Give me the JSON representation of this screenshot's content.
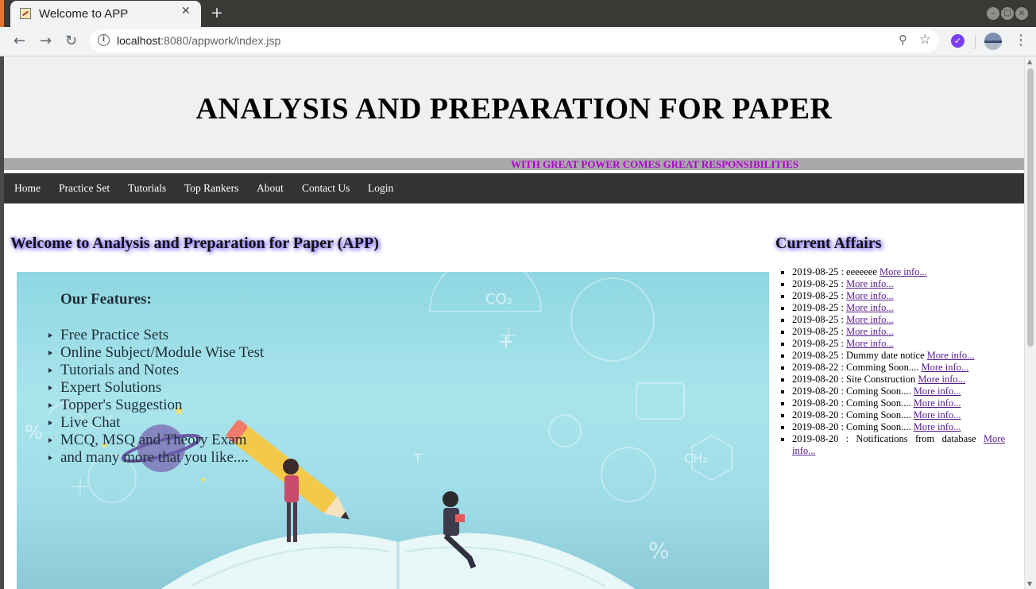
{
  "browser": {
    "tab_title": "Welcome to APP",
    "url_host": "localhost",
    "url_rest": ":8080/appwork/index.jsp"
  },
  "site": {
    "title": "ANALYSIS AND PREPARATION FOR PAPER",
    "tagline": "WITH GREAT POWER COMES GREAT RESPONSIBILITIES",
    "nav": [
      "Home",
      "Practice Set",
      "Tutorials",
      "Top Rankers",
      "About",
      "Contact Us",
      "Login"
    ],
    "welcome_heading": "Welcome to Analysis and Preparation for Paper (APP)",
    "features_title": "Our Features:",
    "features": [
      "Free Practice Sets",
      "Online Subject/Module Wise Test",
      "Tutorials and Notes",
      "Expert Solutions",
      "Topper's Suggestion",
      "Live Chat",
      "MCQ, MSQ and Theory Exam",
      "and many more that you like...."
    ],
    "current_affairs_title": "Current Affairs",
    "current_affairs": [
      {
        "text": "2019-08-25 : eeeeeee",
        "link": "More info..."
      },
      {
        "text": "2019-08-25 :",
        "link": "More info..."
      },
      {
        "text": "2019-08-25 :",
        "link": "More info..."
      },
      {
        "text": "2019-08-25 :",
        "link": "More info..."
      },
      {
        "text": "2019-08-25 :",
        "link": "More info..."
      },
      {
        "text": "2019-08-25 :",
        "link": "More info..."
      },
      {
        "text": "2019-08-25 :",
        "link": "More info..."
      },
      {
        "text": "2019-08-25 : Dummy date notice",
        "link": "More info..."
      },
      {
        "text": "2019-08-22 : Comming Soon....",
        "link": "More info..."
      },
      {
        "text": "2019-08-20 : Site Construction",
        "link": "More info..."
      },
      {
        "text": "2019-08-20 : Coming Soon....",
        "link": "More info..."
      },
      {
        "text": "2019-08-20 : Coming Soon....",
        "link": "More info..."
      },
      {
        "text": "2019-08-20 : Coming Soon....",
        "link": "More info..."
      },
      {
        "text": "2019-08-20 : Coming Soon....",
        "link": "More info..."
      },
      {
        "text": "2019-08-20 : Notifications from database",
        "link": "More info..."
      }
    ]
  },
  "icons": {
    "back": "arrow-left-icon",
    "forward": "arrow-right-icon",
    "reload": "reload-icon",
    "info": "info-icon",
    "zoom": "zoom-icon",
    "bookmark": "star-icon",
    "menu": "kebab-menu-icon"
  },
  "colors": {
    "tagline": "#b000d0",
    "nav_bg": "#333333",
    "header_bg": "#f0f0f0",
    "link": "#551a8b"
  }
}
